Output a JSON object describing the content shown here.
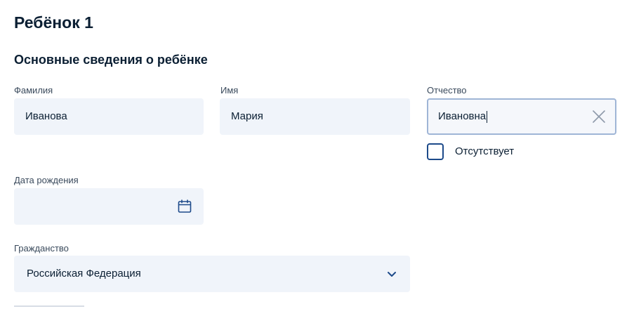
{
  "page": {
    "title": "Ребёнок 1",
    "section_title": "Основные сведения о ребёнке"
  },
  "fields": {
    "last_name": {
      "label": "Фамилия",
      "value": "Иванова"
    },
    "first_name": {
      "label": "Имя",
      "value": "Мария"
    },
    "patronymic": {
      "label": "Отчество",
      "value": "Ивановна"
    },
    "patronymic_absent": {
      "label": "Отсутствует",
      "checked": false
    },
    "birth_date": {
      "label": "Дата рождения",
      "value": ""
    },
    "citizenship": {
      "label": "Гражданство",
      "value": "Российская Федерация"
    }
  },
  "icons": {
    "clear": "close-icon",
    "calendar": "calendar-icon",
    "dropdown": "chevron-down-icon"
  },
  "colors": {
    "field_bg": "#f0f4fa",
    "accent": "#1d4a8a",
    "text": "#0b1f33",
    "active_border": "#9fb5d6"
  }
}
